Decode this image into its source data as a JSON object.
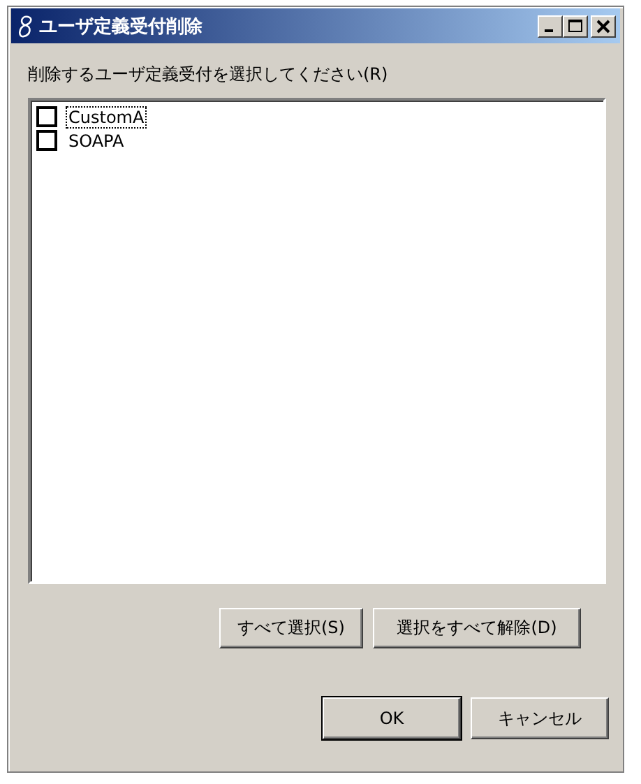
{
  "window": {
    "title": "ユーザ定義受付削除"
  },
  "prompt": "削除するユーザ定義受付を選択してください(R)",
  "items": [
    {
      "label": "CustomA",
      "checked": false,
      "focused": true
    },
    {
      "label": "SOAPA",
      "checked": false,
      "focused": false
    }
  ],
  "list_buttons": [
    "すべて選択(S)",
    "選択をすべて解除(D)"
  ],
  "dialog_buttons": [
    {
      "label": "OK",
      "default": true
    },
    {
      "label": "キャンセル",
      "default": false
    }
  ]
}
